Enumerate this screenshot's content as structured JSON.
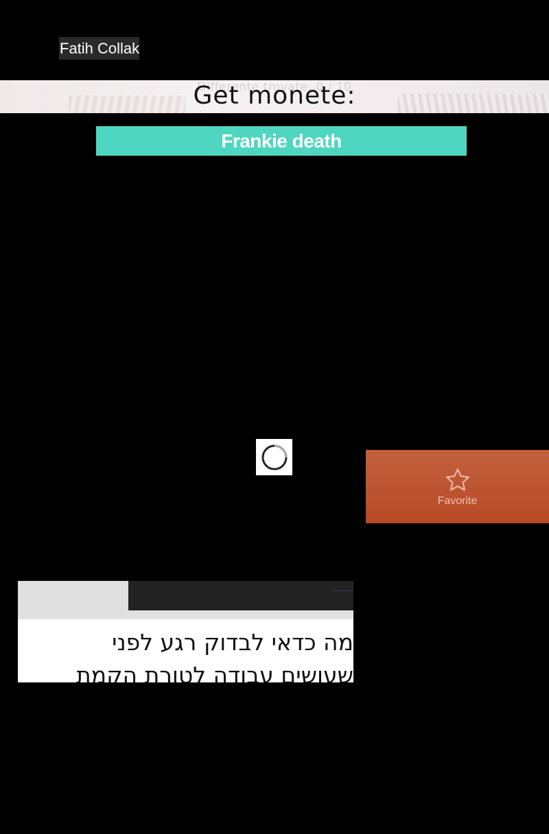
{
  "user": {
    "name": "Fatih Collak"
  },
  "banner": {
    "ghost_text": "Differente trovate: 0 / 10",
    "headline": "Get monete:"
  },
  "pill": {
    "label": "Frankie death"
  },
  "loader": {
    "icon": "spinner-icon"
  },
  "favorite": {
    "label": "Favorite",
    "icon": "star-icon"
  },
  "article": {
    "lines": [
      "מה כדאי לבדוק רגע לפני",
      "שעושים עבודה לטורת הקמת"
    ]
  },
  "colors": {
    "background": "#000000",
    "pill": "#4fd6c0",
    "favorite_top": "#c3603e",
    "favorite_bottom": "#b84a26"
  }
}
